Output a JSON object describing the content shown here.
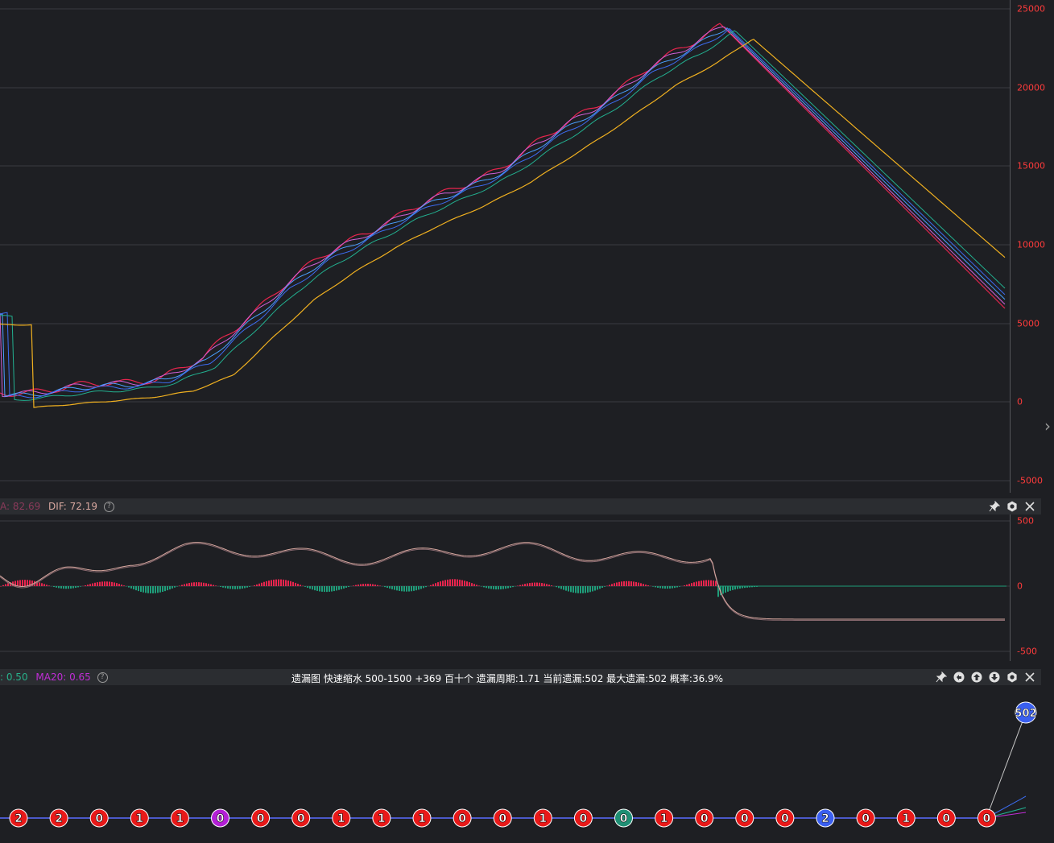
{
  "price_axis": {
    "ticks": [
      "25000",
      "20000",
      "15000",
      "10000",
      "5000",
      "0",
      "-5000"
    ]
  },
  "macd_panel": {
    "legend_partial": "A: 82.69",
    "dif_label": "DIF: 72.19",
    "axis_ticks": [
      "500",
      "0",
      "-500"
    ],
    "tools": [
      "pin-icon",
      "settings-icon",
      "close-icon"
    ]
  },
  "leak_panel": {
    "legend_partial_a": ": 0.50",
    "legend_partial_b": "MA20: 0.65",
    "status_text": "遗漏图   快速缩水   500-1500 +369   百十个   遗漏周期:1.71   当前遗漏:502   最大遗漏:502   概率:36.9%",
    "tools": [
      "pin-icon",
      "undo-icon",
      "up-arrow-icon",
      "down-arrow-icon",
      "settings-icon",
      "close-icon"
    ],
    "bubbles": [
      {
        "v": "2",
        "c": "#e81919"
      },
      {
        "v": "2",
        "c": "#e81919"
      },
      {
        "v": "0",
        "c": "#e81919"
      },
      {
        "v": "1",
        "c": "#e81919"
      },
      {
        "v": "1",
        "c": "#e81919"
      },
      {
        "v": "0",
        "c": "#b31fd6"
      },
      {
        "v": "0",
        "c": "#e81919"
      },
      {
        "v": "0",
        "c": "#e81919"
      },
      {
        "v": "1",
        "c": "#e81919"
      },
      {
        "v": "1",
        "c": "#e81919"
      },
      {
        "v": "1",
        "c": "#e81919"
      },
      {
        "v": "0",
        "c": "#e81919"
      },
      {
        "v": "0",
        "c": "#e81919"
      },
      {
        "v": "1",
        "c": "#e81919"
      },
      {
        "v": "0",
        "c": "#e81919"
      },
      {
        "v": "0",
        "c": "#1f8f74"
      },
      {
        "v": "1",
        "c": "#e81919"
      },
      {
        "v": "0",
        "c": "#e81919"
      },
      {
        "v": "0",
        "c": "#e81919"
      },
      {
        "v": "0",
        "c": "#e81919"
      },
      {
        "v": "2",
        "c": "#3a5ff0"
      },
      {
        "v": "0",
        "c": "#e81919"
      },
      {
        "v": "1",
        "c": "#e81919"
      },
      {
        "v": "0",
        "c": "#e81919"
      },
      {
        "v": "0",
        "c": "#e81919"
      }
    ],
    "peak": {
      "v": "502",
      "c": "#3a5ff0"
    }
  },
  "colors": {
    "grid": "#3a3b40",
    "axis_text": "#ff3b3b",
    "macd_up": "#e8254e",
    "macd_down": "#1f9e7a",
    "dif": "#d8a8a0"
  }
}
